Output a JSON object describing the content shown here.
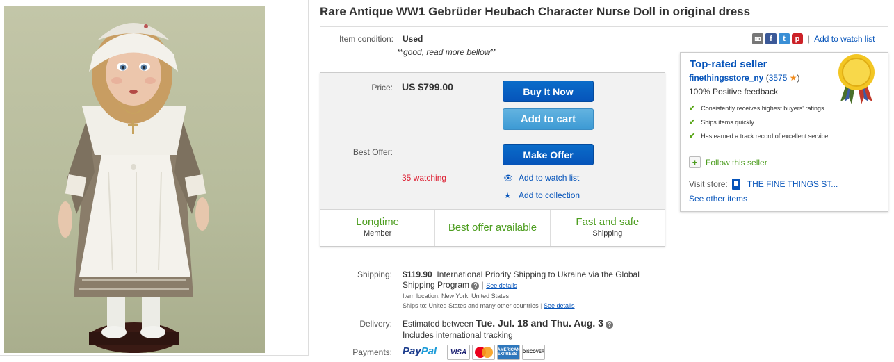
{
  "listing": {
    "title": "Rare Antique WW1 Gebrüder Heubach Character Nurse Doll in original dress",
    "condition_label": "Item condition:",
    "condition_value": "Used",
    "condition_note": "good, read more bellow",
    "quote_open": "“",
    "quote_close": "”"
  },
  "share": {
    "mail": "✉",
    "facebook": "f",
    "twitter": "t",
    "pinterest": "p",
    "separator": "|",
    "watch_label": "Add to watch list"
  },
  "offer": {
    "price_label": "Price:",
    "price_value": "US $799.00",
    "buy_now": "Buy It Now",
    "add_to_cart": "Add to cart",
    "best_offer_label": "Best Offer:",
    "make_offer": "Make Offer",
    "watching": "35 watching",
    "add_watch": "Add to watch list",
    "add_collection": "Add to collection"
  },
  "badges": [
    {
      "main": "Longtime",
      "sub": "Member"
    },
    {
      "main": "Best offer available",
      "sub": ""
    },
    {
      "main": "Fast and safe",
      "sub": "Shipping"
    }
  ],
  "shipping": {
    "label": "Shipping:",
    "cost": "$119.90",
    "method": "International Priority Shipping to Ukraine  via the Global Shipping Program",
    "see_details": "See details",
    "item_location_label": "Item location:",
    "item_location": "New York, United States",
    "ships_to_label": "Ships to:",
    "ships_to": "United States and many other countries",
    "see_details_2": "See details"
  },
  "delivery": {
    "label": "Delivery:",
    "prefix": "Estimated between",
    "dates": "Tue. Jul. 18 and Thu. Aug. 3",
    "tracking": "Includes international tracking"
  },
  "payments": {
    "label": "Payments:",
    "paypal_a": "Pay",
    "paypal_b": "Pal",
    "cards": [
      "VISA",
      "AMERICAN EXPRESS",
      "DISCOVER"
    ]
  },
  "seller": {
    "badge": "Top-rated seller",
    "name": "finethingsstore_ny",
    "feedback_score": "3575",
    "positive": "100% Positive feedback",
    "features": [
      "Consistently receives highest buyers' ratings",
      "Ships items quickly",
      "Has earned a track record of excellent service"
    ],
    "follow": "Follow this seller",
    "visit_label": "Visit store:",
    "store_name": "THE FINE THINGS ST...",
    "see_other": "See other items"
  },
  "colors": {
    "link": "#0654ba",
    "green": "#4e9e21",
    "watching": "#dd1e31"
  }
}
